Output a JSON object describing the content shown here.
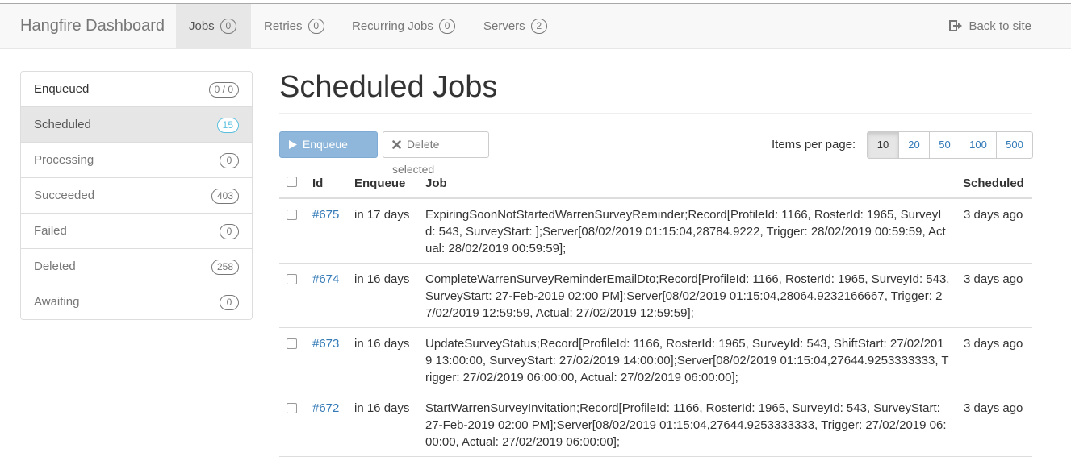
{
  "navbar": {
    "brand": "Hangfire Dashboard",
    "items": [
      {
        "label": "Jobs",
        "count": "0",
        "active": true
      },
      {
        "label": "Retries",
        "count": "0"
      },
      {
        "label": "Recurring Jobs",
        "count": "0"
      },
      {
        "label": "Servers",
        "count": "2"
      }
    ],
    "back_label": "Back to site",
    "back_icon": "sign-out-icon"
  },
  "sidebar": {
    "items": [
      {
        "label": "Enqueued",
        "count": "0 / 0"
      },
      {
        "label": "Scheduled",
        "count": "15",
        "active": true
      },
      {
        "label": "Processing",
        "count": "0"
      },
      {
        "label": "Succeeded",
        "count": "403"
      },
      {
        "label": "Failed",
        "count": "0"
      },
      {
        "label": "Deleted",
        "count": "258"
      },
      {
        "label": "Awaiting",
        "count": "0"
      }
    ]
  },
  "main": {
    "title": "Scheduled Jobs",
    "enqueue_label": "Enqueue now",
    "delete_label": "Delete selected",
    "items_per_page_label": "Items per page:",
    "page_sizes": [
      "10",
      "20",
      "50",
      "100",
      "500"
    ],
    "active_page_size": "10"
  },
  "table": {
    "headers": {
      "id": "Id",
      "enqueue": "Enqueue",
      "job": "Job",
      "scheduled": "Scheduled"
    },
    "rows": [
      {
        "id": "#675",
        "enqueue": "in 17 days",
        "job": "ExpiringSoonNotStartedWarrenSurveyReminder;Record[ProfileId: 1166, RosterId: 1965, SurveyId: 543, SurveyStart: ];Server[08/02/2019 01:15:04,28784.9222, Trigger: 28/02/2019 00:59:59, Actual: 28/02/2019 00:59:59];",
        "scheduled": "3 days ago"
      },
      {
        "id": "#674",
        "enqueue": "in 16 days",
        "job": "CompleteWarrenSurveyReminderEmailDto;Record[ProfileId: 1166, RosterId: 1965, SurveyId: 543, SurveyStart: 27-Feb-2019 02:00 PM];Server[08/02/2019 01:15:04,28064.9232166667, Trigger: 27/02/2019 12:59:59, Actual: 27/02/2019 12:59:59];",
        "scheduled": "3 days ago"
      },
      {
        "id": "#673",
        "enqueue": "in 16 days",
        "job": "UpdateSurveyStatus;Record[ProfileId: 1166, RosterId: 1965, SurveyId: 543, ShiftStart: 27/02/2019 13:00:00, SurveyStart: 27/02/2019 14:00:00];Server[08/02/2019 01:15:04,27644.9253333333, Trigger: 27/02/2019 06:00:00, Actual: 27/02/2019 06:00:00];",
        "scheduled": "3 days ago"
      },
      {
        "id": "#672",
        "enqueue": "in 16 days",
        "job": "StartWarrenSurveyInvitation;Record[ProfileId: 1166, RosterId: 1965, SurveyId: 543, SurveyStart: 27-Feb-2019 02:00 PM];Server[08/02/2019 01:15:04,27644.9253333333, Trigger: 27/02/2019 06:00:00, Actual: 27/02/2019 06:00:00];",
        "scheduled": "3 days ago"
      }
    ]
  },
  "colors": {
    "link": "#337ab7",
    "primary_button": "#8fb7db",
    "info_badge": "#5bc0de",
    "navbar_bg": "#f8f8f8"
  }
}
